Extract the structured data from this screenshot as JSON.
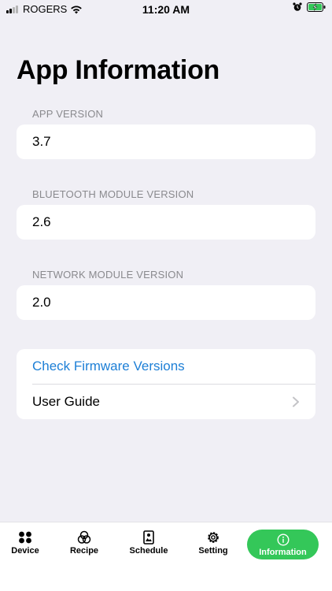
{
  "status_bar": {
    "carrier": "ROGERS",
    "time": "11:20 AM"
  },
  "page": {
    "title": "App Information"
  },
  "sections": [
    {
      "header": "APP VERSION",
      "value": "3.7"
    },
    {
      "header": "BLUETOOTH MODULE VERSION",
      "value": "2.6"
    },
    {
      "header": "NETWORK MODULE VERSION",
      "value": "2.0"
    }
  ],
  "links": {
    "check_firmware": "Check Firmware Versions",
    "user_guide": "User Guide"
  },
  "tabs": [
    {
      "label": "Device",
      "icon": "device-grid-icon"
    },
    {
      "label": "Recipe",
      "icon": "recipe-icon"
    },
    {
      "label": "Schedule",
      "icon": "schedule-icon"
    },
    {
      "label": "Setting",
      "icon": "gear-icon"
    },
    {
      "label": "Information",
      "icon": "info-icon",
      "active": true
    }
  ],
  "colors": {
    "accent_link": "#1d7fd6",
    "active_tab": "#34c759",
    "background": "#f0eff5",
    "battery": "#34c759"
  }
}
